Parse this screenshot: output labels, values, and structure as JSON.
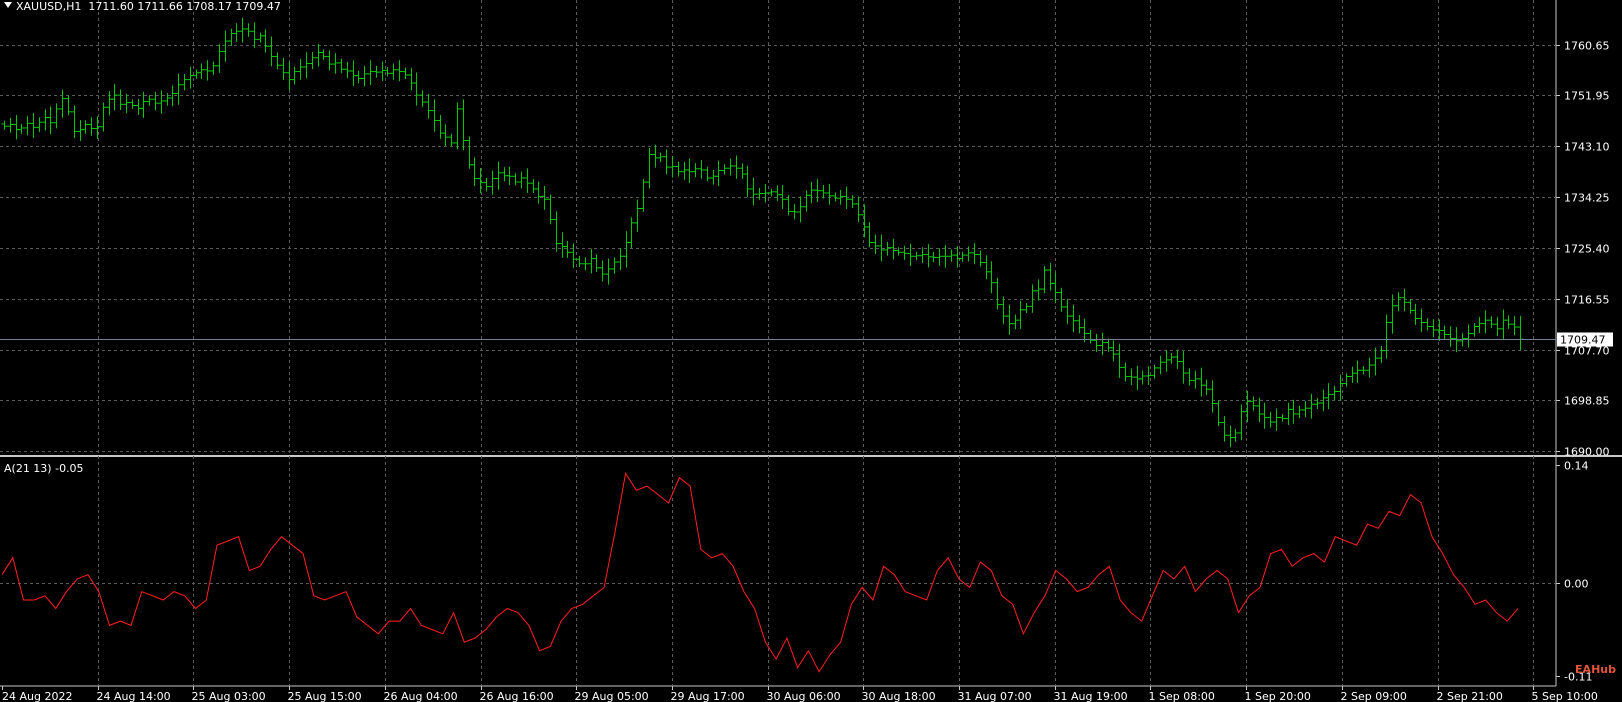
{
  "header": {
    "symbol": "XAUUSD,H1",
    "ohlc": "1711.60 1711.66 1708.17 1709.47"
  },
  "indicator": {
    "label": "A(21 13) -0.05"
  },
  "watermark": "EAHub",
  "colors": {
    "background": "#000000",
    "grid": "#5a5a5a",
    "candles": "#00c800",
    "indicator_line": "#ff2020",
    "price_line": "#708090",
    "text": "#ffffff"
  },
  "chart_data": [
    {
      "type": "ohlc",
      "title": "XAUUSD,H1",
      "y_ticks": [
        "1760.65",
        "1751.95",
        "1743.10",
        "1734.25",
        "1725.40",
        "1716.55",
        "1707.70",
        "1698.85",
        "1690.00"
      ],
      "current_price": "1709.47",
      "ylim": [
        1688.5,
        1766
      ],
      "x_ticks": [
        "24 Aug 2022",
        "24 Aug 14:00",
        "25 Aug 03:00",
        "25 Aug 15:00",
        "26 Aug 04:00",
        "26 Aug 16:00",
        "29 Aug 05:00",
        "29 Aug 17:00",
        "30 Aug 06:00",
        "30 Aug 18:00",
        "31 Aug 07:00",
        "31 Aug 19:00",
        "1 Sep 08:00",
        "1 Sep 20:00",
        "2 Sep 09:00",
        "2 Sep 21:00",
        "5 Sep 10:00"
      ],
      "close_path": [
        1746.5,
        1746.8,
        1745.9,
        1746.2,
        1747.0,
        1746.3,
        1747.2,
        1748.0,
        1747.1,
        1749.5,
        1751.3,
        1749.0,
        1745.6,
        1745.9,
        1746.8,
        1746.1,
        1746.4,
        1749.8,
        1751.2,
        1751.9,
        1750.3,
        1750.6,
        1750.1,
        1749.6,
        1750.8,
        1751.2,
        1750.5,
        1750.9,
        1751.4,
        1752.2,
        1753.7,
        1754.6,
        1755.3,
        1755.8,
        1756.3,
        1756.1,
        1757.0,
        1759.5,
        1761.3,
        1762.6,
        1763.0,
        1763.4,
        1763.0,
        1761.6,
        1762.2,
        1760.4,
        1758.6,
        1757.1,
        1755.8,
        1754.6,
        1756.0,
        1756.8,
        1757.4,
        1758.4,
        1759.3,
        1758.6,
        1757.3,
        1757.5,
        1756.4,
        1756.1,
        1755.3,
        1754.8,
        1755.6,
        1756.0,
        1755.9,
        1756.2,
        1755.7,
        1756.3,
        1756.0,
        1755.4,
        1754.0,
        1751.9,
        1750.7,
        1749.2,
        1747.5,
        1745.3,
        1744.6,
        1743.6,
        1749.5,
        1744.0,
        1739.8,
        1737.4,
        1736.7,
        1736.0,
        1737.4,
        1738.4,
        1737.9,
        1737.8,
        1736.8,
        1737.5,
        1736.6,
        1735.6,
        1734.3,
        1733.8,
        1730.3,
        1726.1,
        1725.6,
        1724.6,
        1723.4,
        1722.6,
        1722.6,
        1723.5,
        1721.9,
        1720.8,
        1721.7,
        1722.9,
        1723.9,
        1726.3,
        1729.7,
        1732.2,
        1736.8,
        1741.6,
        1741.0,
        1741.2,
        1739.4,
        1739.5,
        1738.6,
        1738.9,
        1738.6,
        1739.1,
        1738.9,
        1737.5,
        1737.8,
        1738.8,
        1739.2,
        1739.6,
        1739.2,
        1738.2,
        1735.6,
        1734.7,
        1734.8,
        1734.9,
        1735.1,
        1734.6,
        1733.8,
        1731.7,
        1731.6,
        1732.5,
        1734.5,
        1735.4,
        1735.3,
        1734.9,
        1734.4,
        1734.0,
        1734.3,
        1733.8,
        1733.0,
        1731.1,
        1729.0,
        1726.3,
        1725.7,
        1725.0,
        1725.4,
        1724.9,
        1724.6,
        1724.4,
        1723.9,
        1724.0,
        1724.2,
        1723.8,
        1723.7,
        1723.9,
        1723.9,
        1724.1,
        1723.5,
        1724.1,
        1724.5,
        1724.2,
        1722.8,
        1721.2,
        1719.3,
        1715.5,
        1713.5,
        1712.2,
        1712.8,
        1714.6,
        1715.2,
        1717.9,
        1718.2,
        1721.5,
        1719.2,
        1717.6,
        1715.1,
        1713.5,
        1712.7,
        1711.5,
        1710.5,
        1709.3,
        1708.4,
        1708.9,
        1708.0,
        1706.9,
        1704.6,
        1703.0,
        1702.9,
        1702.6,
        1703.1,
        1703.2,
        1704.5,
        1705.5,
        1705.9,
        1706.4,
        1705.6,
        1703.6,
        1702.3,
        1702.6,
        1701.5,
        1700.8,
        1698.3,
        1695.0,
        1692.8,
        1692.4,
        1693.2,
        1696.9,
        1698.7,
        1697.9,
        1696.5,
        1695.9,
        1695.1,
        1695.9,
        1695.7,
        1697.3,
        1696.5,
        1697.2,
        1697.5,
        1698.2,
        1698.4,
        1699.3,
        1699.9,
        1700.4,
        1701.8,
        1703.0,
        1703.6,
        1704.1,
        1704.1,
        1705.0,
        1706.2,
        1707.5,
        1712.4,
        1715.3,
        1716.7,
        1715.9,
        1714.5,
        1713.1,
        1712.4,
        1711.7,
        1711.1,
        1711.0,
        1710.3,
        1709.6,
        1709.2,
        1709.6,
        1710.5,
        1711.7,
        1712.2,
        1712.8,
        1712.1,
        1711.3,
        1712.8,
        1712.1,
        1711.6,
        1709.5
      ]
    },
    {
      "type": "line",
      "series": [
        {
          "name": "A(21 13)",
          "values": [
            0.01,
            0.03,
            -0.02,
            -0.02,
            -0.015,
            -0.03,
            -0.01,
            0.005,
            0.01,
            -0.01,
            -0.05,
            -0.045,
            -0.05,
            -0.01,
            -0.015,
            -0.02,
            -0.01,
            -0.015,
            -0.03,
            -0.02,
            0.045,
            0.05,
            0.055,
            0.015,
            0.02,
            0.04,
            0.055,
            0.045,
            0.035,
            -0.015,
            -0.02,
            -0.015,
            -0.01,
            -0.04,
            -0.05,
            -0.06,
            -0.045,
            -0.045,
            -0.03,
            -0.05,
            -0.055,
            -0.06,
            -0.035,
            -0.07,
            -0.065,
            -0.055,
            -0.04,
            -0.03,
            -0.035,
            -0.05,
            -0.08,
            -0.075,
            -0.045,
            -0.03,
            -0.025,
            -0.015,
            -0.005,
            0.06,
            0.13,
            0.11,
            0.115,
            0.105,
            0.095,
            0.125,
            0.115,
            0.04,
            0.03,
            0.035,
            0.02,
            -0.01,
            -0.03,
            -0.07,
            -0.09,
            -0.065,
            -0.1,
            -0.08,
            -0.105,
            -0.085,
            -0.07,
            -0.025,
            -0.005,
            -0.02,
            0.02,
            0.01,
            -0.01,
            -0.015,
            -0.02,
            0.015,
            0.03,
            0.005,
            -0.005,
            0.025,
            0.015,
            -0.015,
            -0.025,
            -0.06,
            -0.035,
            -0.015,
            0.015,
            0.005,
            -0.01,
            -0.005,
            0.01,
            0.02,
            -0.02,
            -0.035,
            -0.045,
            -0.015,
            0.015,
            0.005,
            0.02,
            -0.01,
            0.005,
            0.015,
            0.005,
            -0.035,
            -0.015,
            -0.005,
            0.035,
            0.04,
            0.02,
            0.03,
            0.035,
            0.025,
            0.055,
            0.05,
            0.045,
            0.07,
            0.065,
            0.085,
            0.08,
            0.105,
            0.095,
            0.055,
            0.035,
            0.01,
            -0.005,
            -0.025,
            -0.02,
            -0.035,
            -0.045,
            -0.03
          ]
        }
      ],
      "y_ticks": [
        "0.14",
        "0.00",
        "-0.11"
      ],
      "ylim": [
        -0.11,
        0.14
      ],
      "grid": true
    }
  ]
}
